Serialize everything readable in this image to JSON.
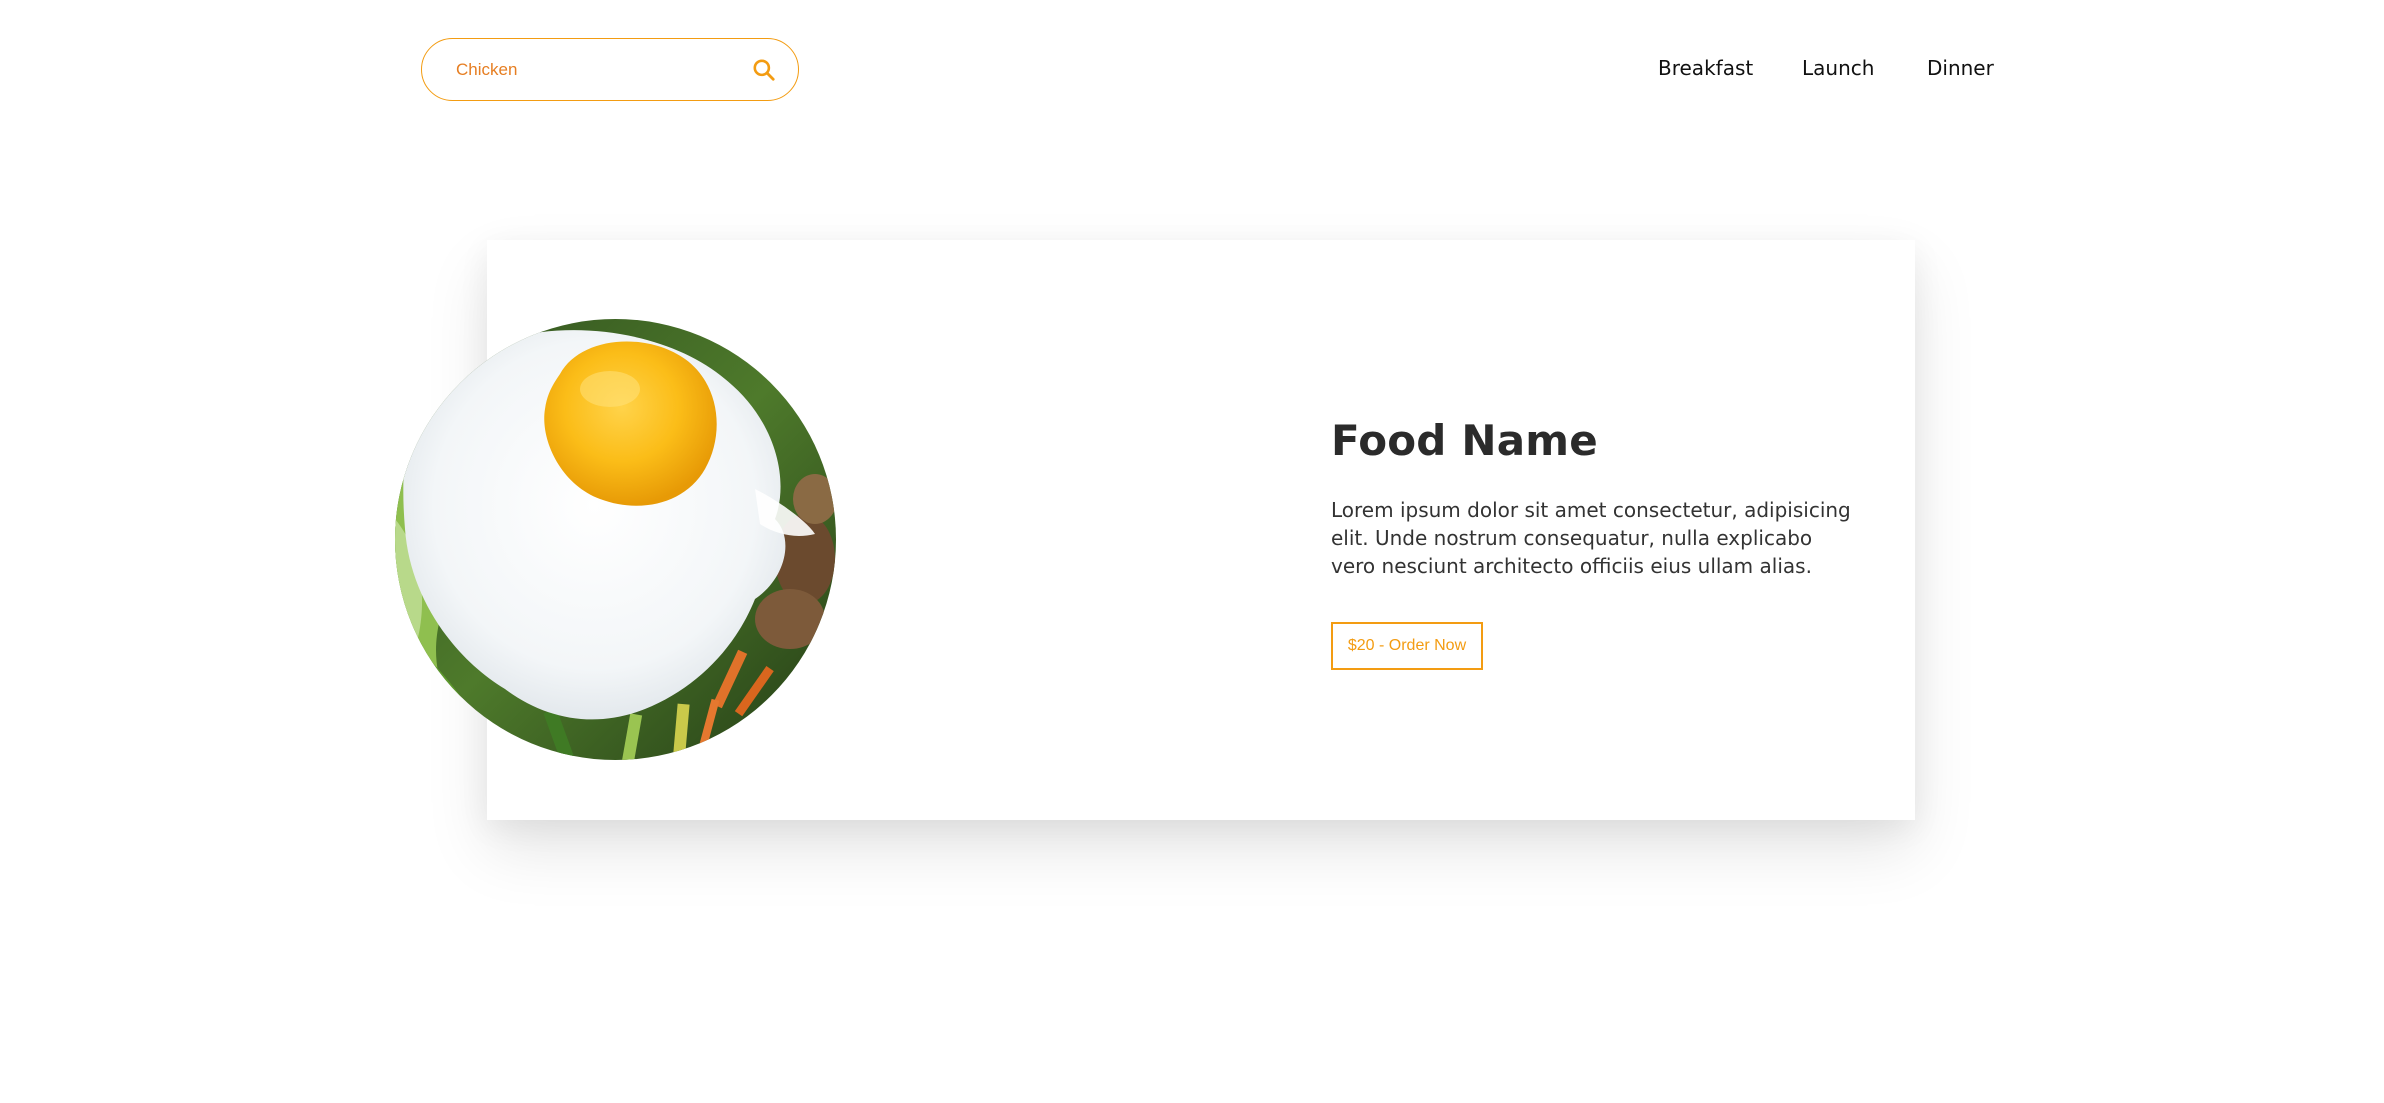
{
  "search": {
    "value": "Chicken",
    "icon": "search-icon"
  },
  "nav": {
    "items": [
      {
        "label": "Breakfast"
      },
      {
        "label": "Launch"
      },
      {
        "label": "Dinner"
      }
    ]
  },
  "card": {
    "title": "Food Name",
    "description": "Lorem ipsum dolor sit amet consectetur, adipisicing elit. Unde nostrum consequatur, nulla explicabo vero nesciunt architecto officiis eius ullam alias.",
    "order_label": "$20 - Order Now",
    "image_icon": "fried-egg-food-image"
  },
  "colors": {
    "accent": "#f39c12",
    "search_text": "#e67e22",
    "title": "#2b2b2b",
    "text": "#333333",
    "nav_text": "#111111"
  }
}
